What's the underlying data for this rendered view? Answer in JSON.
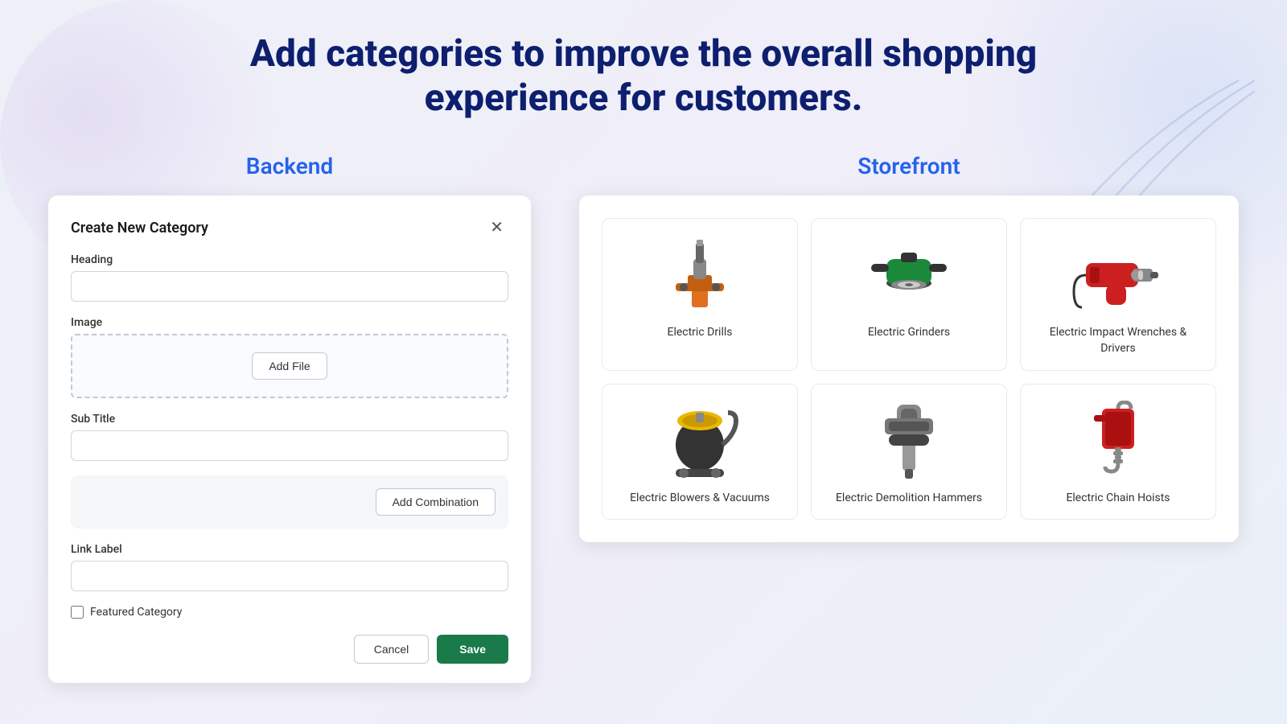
{
  "page": {
    "heading_line1": "Add categories to improve the overall shopping",
    "heading_line2": "experience for customers.",
    "backend_label": "Backend",
    "storefront_label": "Storefront"
  },
  "modal": {
    "title": "Create New Category",
    "heading_label": "Heading",
    "heading_placeholder": "",
    "image_label": "Image",
    "add_file_btn": "Add File",
    "subtitle_label": "Sub Title",
    "subtitle_placeholder": "",
    "add_combination_btn": "Add Combination",
    "link_label_label": "Link Label",
    "link_label_placeholder": "",
    "featured_category_label": "Featured Category",
    "cancel_btn": "Cancel",
    "save_btn": "Save"
  },
  "storefront": {
    "categories": [
      {
        "id": 1,
        "name": "Electric Drills",
        "row": 1,
        "col": 1
      },
      {
        "id": 2,
        "name": "Electric Grinders",
        "row": 1,
        "col": 2
      },
      {
        "id": 3,
        "name": "Electric Impact Wrenches & Drivers",
        "row": 1,
        "col": 3
      },
      {
        "id": 4,
        "name": "Electric Blowers & Vacuums",
        "row": 2,
        "col": 1
      },
      {
        "id": 5,
        "name": "Electric Demolition Hammers",
        "row": 2,
        "col": 2
      },
      {
        "id": 6,
        "name": "Electric Chain Hoists",
        "row": 2,
        "col": 3
      }
    ]
  }
}
